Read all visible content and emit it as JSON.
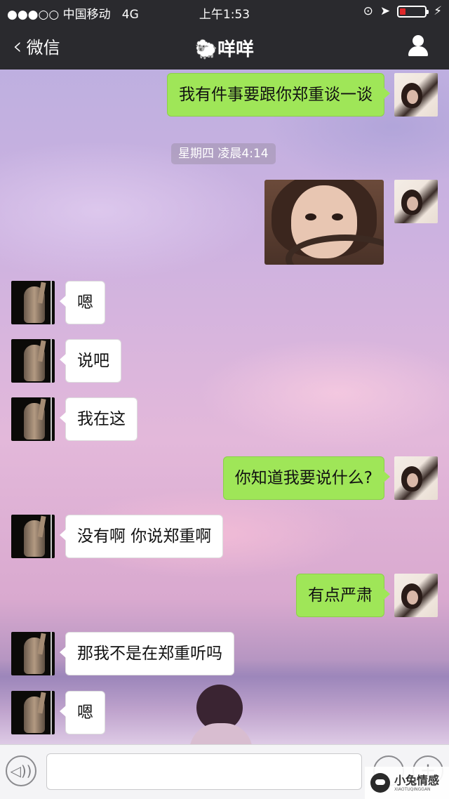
{
  "status_bar": {
    "signal": "●●●○○",
    "carrier": "中国移动",
    "network": "4G",
    "time": "上午1:53"
  },
  "nav": {
    "back_label": "微信",
    "title": "🐑咩咩"
  },
  "timestamp": "星期四 凌晨4:14",
  "messages": [
    {
      "from": "me",
      "text": "我有件事要跟你郑重谈一谈"
    },
    {
      "from": "me",
      "type": "image"
    },
    {
      "from": "them",
      "text": "嗯"
    },
    {
      "from": "them",
      "text": "说吧"
    },
    {
      "from": "them",
      "text": "我在这"
    },
    {
      "from": "me",
      "text": "你知道我要说什么?"
    },
    {
      "from": "them",
      "text": "没有啊 你说郑重啊"
    },
    {
      "from": "me",
      "text": "有点严肃"
    },
    {
      "from": "them",
      "text": "那我不是在郑重听吗"
    },
    {
      "from": "them",
      "text": "嗯"
    }
  ],
  "watermark": {
    "name": "小兔情感",
    "sub": "XIAOTUQINGGAN"
  },
  "colors": {
    "sent_bubble": "#9fe658",
    "received_bubble": "#ffffff",
    "header_bg": "#2a2a2e"
  }
}
